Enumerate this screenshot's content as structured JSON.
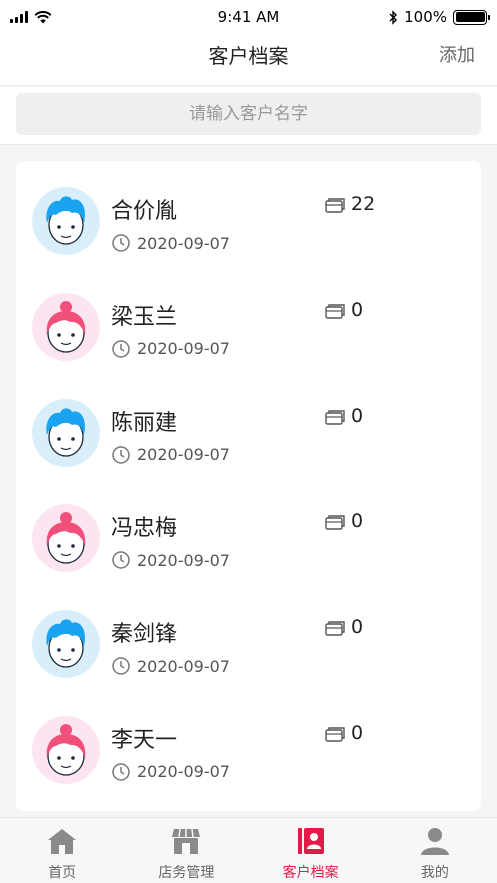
{
  "status_bar": {
    "time": "9:41 AM",
    "battery": "100%"
  },
  "header": {
    "title": "客户档案",
    "action_label": "添加"
  },
  "search": {
    "placeholder": "请输入客户名字",
    "value": ""
  },
  "customers": [
    {
      "name": "合价胤",
      "date": "2020-09-07",
      "count": "22",
      "gender": "male"
    },
    {
      "name": "梁玉兰",
      "date": "2020-09-07",
      "count": "0",
      "gender": "female"
    },
    {
      "name": "陈丽建",
      "date": "2020-09-07",
      "count": "0",
      "gender": "male"
    },
    {
      "name": "冯忠梅",
      "date": "2020-09-07",
      "count": "0",
      "gender": "female"
    },
    {
      "name": "秦剑锋",
      "date": "2020-09-07",
      "count": "0",
      "gender": "male"
    },
    {
      "name": "李天一",
      "date": "2020-09-07",
      "count": "0",
      "gender": "female"
    }
  ],
  "tabs": [
    {
      "label": "首页",
      "icon": "home-icon"
    },
    {
      "label": "店务管理",
      "icon": "store-icon"
    },
    {
      "label": "客户档案",
      "icon": "customer-file-icon",
      "active": true
    },
    {
      "label": "我的",
      "icon": "user-icon"
    }
  ],
  "colors": {
    "accent": "#e5184a",
    "male_bg": "#d8eefb",
    "female_bg": "#fde4f1"
  }
}
